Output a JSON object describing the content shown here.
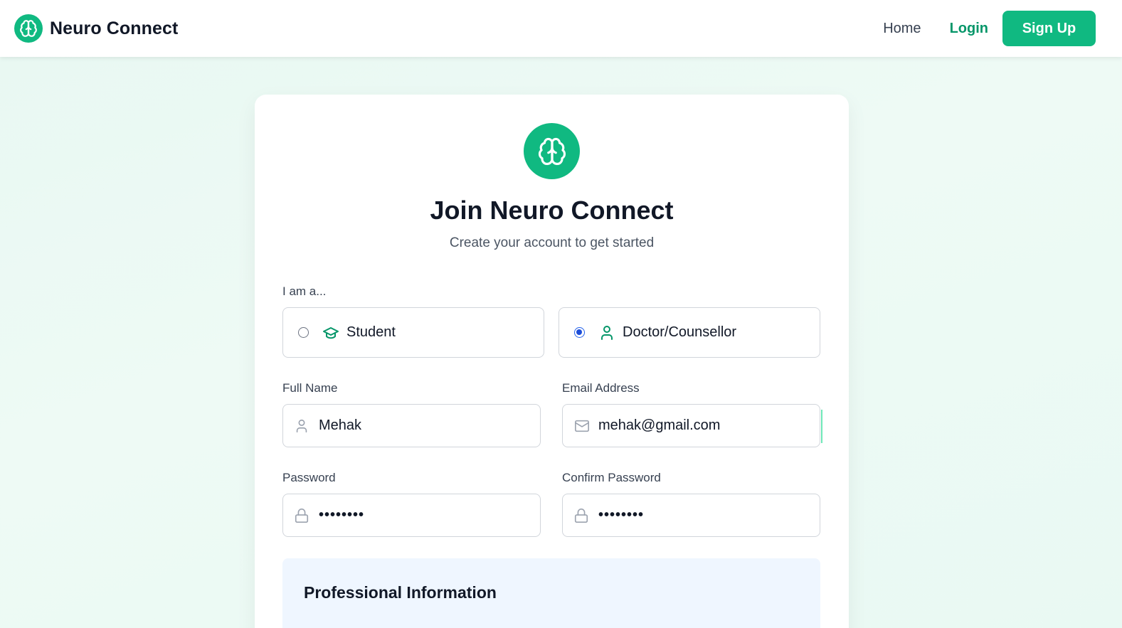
{
  "header": {
    "brand": "Neuro Connect",
    "brand_icon": "brain-icon",
    "nav": {
      "home": "Home",
      "login": "Login",
      "signup": "Sign Up"
    }
  },
  "form": {
    "logo_icon": "brain-icon",
    "title": "Join Neuro Connect",
    "subtitle": "Create your account to get started",
    "role_label": "I am a...",
    "roles": [
      {
        "label": "Student",
        "icon": "graduation-cap-icon",
        "selected": false
      },
      {
        "label": "Doctor/Counsellor",
        "icon": "user-icon",
        "selected": true
      }
    ],
    "fields": {
      "full_name": {
        "label": "Full Name",
        "value": "Mehak",
        "icon": "user-icon"
      },
      "email": {
        "label": "Email Address",
        "value": "mehak@gmail.com",
        "icon": "mail-icon"
      },
      "password": {
        "label": "Password",
        "value": "••••••••",
        "icon": "lock-icon"
      },
      "confirm_password": {
        "label": "Confirm Password",
        "value": "••••••••",
        "icon": "lock-icon"
      }
    },
    "professional_section_title": "Professional Information"
  },
  "colors": {
    "accent": "#10b981",
    "accent_text": "#059669",
    "radio_selected": "#1d4ed8",
    "section_bg": "#eff6ff"
  }
}
